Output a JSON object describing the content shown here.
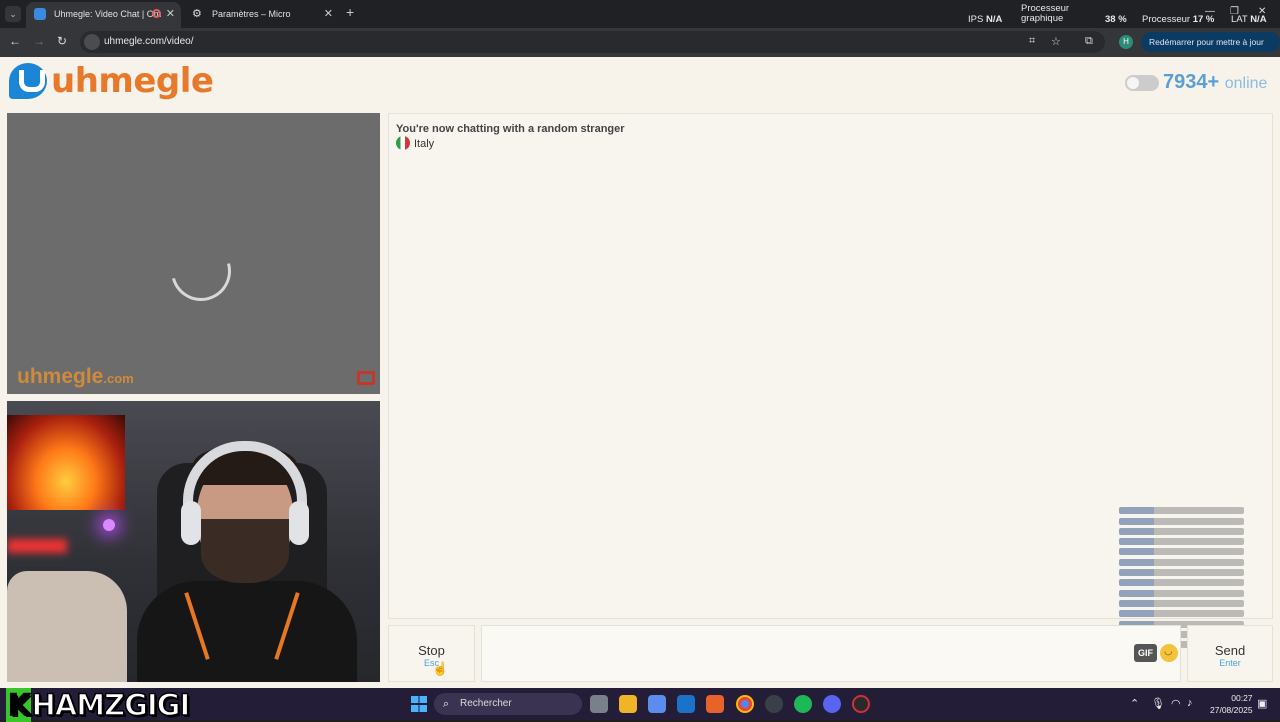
{
  "browser": {
    "tabs": [
      {
        "label": "Uhmegle: Video Chat | Om",
        "active": true
      },
      {
        "label": "Paramètres – Micro",
        "active": false
      }
    ],
    "new_tab": "+",
    "url": "uhmegle.com/video/",
    "update_button": "Redémarrer pour mettre à jour",
    "profile_initial": "H",
    "hud": {
      "ips_label": "IPS",
      "ips_value": "N/A",
      "gpu_label_1": "Processeur",
      "gpu_label_2": "graphique",
      "gpu_value": "38 %",
      "cpu_label": "Processeur",
      "cpu_value": "17 %",
      "lat_label": "LAT",
      "lat_value": "N/A"
    }
  },
  "site": {
    "logo_text": "uhmegle",
    "online_count": "7934+",
    "online_label": "online",
    "watermark_main": "uhmegle",
    "watermark_suffix": ".com"
  },
  "chat": {
    "status_message": "You're now chatting with a random stranger",
    "country": "Italy",
    "stop_label": "Stop",
    "stop_key": "Esc",
    "send_label": "Send",
    "send_key": "Enter",
    "gif_label": "GIF",
    "input_value": ""
  },
  "taskbar": {
    "overlay_first": "K",
    "overlay_rest": "HAMZGIGI",
    "search_placeholder": "Rechercher",
    "time": "00:27",
    "date": "27/08/2025"
  },
  "colors": {
    "brand_orange": "#e9792a",
    "brand_blue": "#1c86d6",
    "online_blue": "#5aa0d6",
    "key_hint_blue": "#4aa3d8"
  }
}
